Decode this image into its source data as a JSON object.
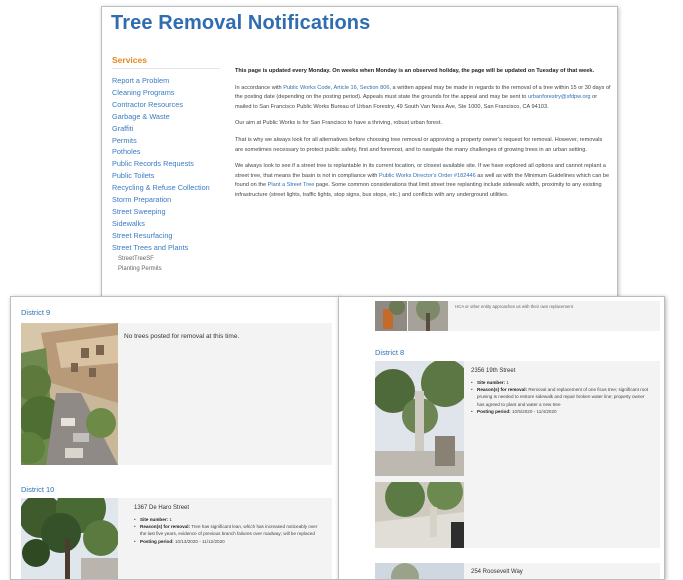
{
  "page": {
    "title": "Tree Removal Notifications"
  },
  "sidebar": {
    "heading": "Services",
    "items": [
      "Report a Problem",
      "Cleaning Programs",
      "Contractor Resources",
      "Garbage & Waste",
      "Graffiti",
      "Permits",
      "Potholes",
      "Public Records Requests",
      "Public Toilets",
      "Recycling & Refuse Collection",
      "Storm Preparation",
      "Street Sweeping",
      "Sidewalks",
      "Street Resurfacing",
      "Street Trees and Plants"
    ],
    "subitems": [
      "StreetTreeSF",
      "Planting Permits"
    ]
  },
  "content": {
    "notice": "This page is updated every Monday. On weeks when Monday is an observed holiday, the page will be updated on Tuesday of that week.",
    "appeal_a": "In accordance with ",
    "appeal_link1": "Public Works Code, Article 16, Section 806",
    "appeal_b": ", a written appeal may be made in regards to the removal of a tree within 15 or 30 days of the posting date (depending on the posting period). Appeals must state the grounds for the appeal and may be sent to ",
    "appeal_email": "urbanforestry@sfdpw.org",
    "appeal_c": " or mailed to San Francisco Public Works Bureau of Urban Forestry, 49 South Van Ness Ave, Ste 1000, San Francisco, CA 94103.",
    "aim": "Our aim at Public Works is for San Francisco to have a thriving, robust urban forest.",
    "alternatives": "That is why we always look for all alternatives before choosing tree removal or approving a property owner's request for removal. However, removals are sometimes necessary to protect public safety, first and foremost, and to navigate the many challenges of growing trees in an urban setting.",
    "replant_a": "We always look to see if a street tree is replantable in its current location, or closest available site. If we have explored all options and cannot replant a street tree, that means the basin is not in compliance with ",
    "replant_link1": "Public Works Director's Order #182446",
    "replant_b": " as well as with the Minimum Guidelines which can be found on the ",
    "replant_link2": "Plant a Street Tree",
    "replant_c": " page. Some common considerations that limit street tree replanting include sidewalk width, proximity to any existing infrastructure (street lights, traffic lights, stop signs, bus stops, etc.) and conflicts with any underground utilities."
  },
  "left_panel": {
    "district9": {
      "heading": "District 9",
      "message": "No trees posted for removal at this time."
    },
    "district10": {
      "heading": "District 10",
      "address": "1367 De Haro Street",
      "site_label": "Site number:",
      "site_value": "1",
      "reason_label": "Reason(s) for removal:",
      "reason_value": "Tree has significant lean, which has increased noticeably over the last five years, evidence of previous branch failures over roadway; will be replaced",
      "period_label": "Posting period:",
      "period_value": "10/13/2020 - 11/12/2020"
    }
  },
  "right_panel": {
    "top_fragment": "HCA or other entity approaches us with their own replacement",
    "district8": {
      "heading": "District 8",
      "address": "2356 19th Street",
      "site_label": "Site number:",
      "site_value": "1",
      "reason_label": "Reason(s) for removal:",
      "reason_value": "Removal and replacement of one ficus tree; significant root pruning is needed to restore sidewalk and repair broken water line; property owner has agreed to plant and water a new tree",
      "period_label": "Posting period:",
      "period_value": "10/5/2020 - 11/4/2020"
    },
    "next_address": "254 Roosevelt Way"
  },
  "colors": {
    "title_blue": "#2f6cb1",
    "link_blue": "#2e6fb3",
    "services_orange": "#e08a1e",
    "card_gray": "#f3f3f3"
  }
}
